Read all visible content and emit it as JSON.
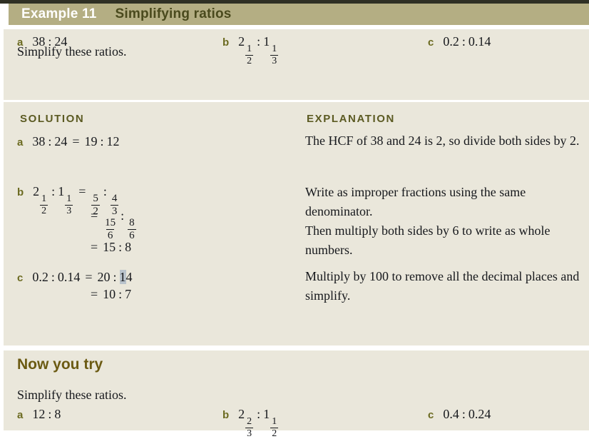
{
  "colors": {
    "top_rule": "#2f3024",
    "header_bar": "#b4ae83",
    "panel_bg": "#eae7db",
    "page_bg": "#ffffff",
    "part_letter": "#6b6a20",
    "col_heading": "#5b5a22",
    "header_label": "#ffffff",
    "header_title": "#4a4a1d",
    "nyt_heading": "#6b5a12",
    "body_text": "#16181c",
    "caret_highlight": "#b9c3cc"
  },
  "header": {
    "label": "Example 11",
    "title": "Simplifying ratios"
  },
  "question": {
    "prompt": "Simplify these ratios.",
    "parts": [
      {
        "letter": "a",
        "whole1": "38",
        "colon": ":",
        "whole2": "24"
      },
      {
        "letter": "b",
        "mixed1_whole": "2",
        "mixed1_num": "1",
        "mixed1_den": "2",
        "colon": ":",
        "mixed2_whole": "1",
        "mixed2_num": "1",
        "mixed2_den": "3"
      },
      {
        "letter": "c",
        "whole1": "0.2",
        "colon": ":",
        "whole2": "0.14"
      }
    ]
  },
  "columns": {
    "solution_heading": "SOLUTION",
    "explanation_heading": "EXPLANATION"
  },
  "solution": {
    "a": {
      "letter": "a",
      "lhs1": "38",
      "colon1": ":",
      "lhs2": "24",
      "eq": "=",
      "rhs1": "19",
      "colon2": ":",
      "rhs2": "12"
    },
    "b": {
      "letter": "b",
      "line1": {
        "mixed1_whole": "2",
        "mixed1_num": "1",
        "mixed1_den": "2",
        "colon1": ":",
        "mixed2_whole": "1",
        "mixed2_num": "1",
        "mixed2_den": "3",
        "eq": "=",
        "frac1_num": "5",
        "frac1_den": "2",
        "colon2": ":",
        "frac2_num": "4",
        "frac2_den": "3"
      },
      "line2": {
        "eq": "=",
        "frac1_num": "15",
        "frac1_den": "6",
        "colon": ":",
        "frac2_num": "8",
        "frac2_den": "6"
      },
      "line3": {
        "eq": "=",
        "val1": "15",
        "colon": ":",
        "val2": "8"
      }
    },
    "c": {
      "letter": "c",
      "line1": {
        "lhs1": "0.2",
        "colon1": ":",
        "lhs2": "0.14",
        "eq": "=",
        "rhs1": "20",
        "colon2": ":",
        "rhs2_highlight": "1",
        "rhs2_rest": "4"
      },
      "line2": {
        "eq": "=",
        "val1": "10",
        "colon": ":",
        "val2": "7"
      }
    }
  },
  "explanation": {
    "para1": "The HCF of 38 and 24 is 2, so divide both sides by 2.",
    "para2": "Write as improper fractions using the same denominator. Then multiply both sides by 6 to write as whole numbers.",
    "para2_line1": "Write as improper fractions using the same",
    "para2_line2": "denominator.",
    "para2_line3": "Then multiply both sides by 6 to write as whole",
    "para2_line4": "numbers.",
    "para3": "Multiply by 100 to remove all the decimal places and simplify."
  },
  "now_you_try": {
    "heading": "Now you try",
    "prompt": "Simplify these ratios.",
    "parts": [
      {
        "letter": "a",
        "whole1": "12",
        "colon": ":",
        "whole2": "8"
      },
      {
        "letter": "b",
        "mixed1_whole": "2",
        "mixed1_num": "2",
        "mixed1_den": "3",
        "colon": ":",
        "mixed2_whole": "1",
        "mixed2_num": "1",
        "mixed2_den": "2"
      },
      {
        "letter": "c",
        "whole1": "0.4",
        "colon": ":",
        "whole2": "0.24"
      }
    ]
  }
}
